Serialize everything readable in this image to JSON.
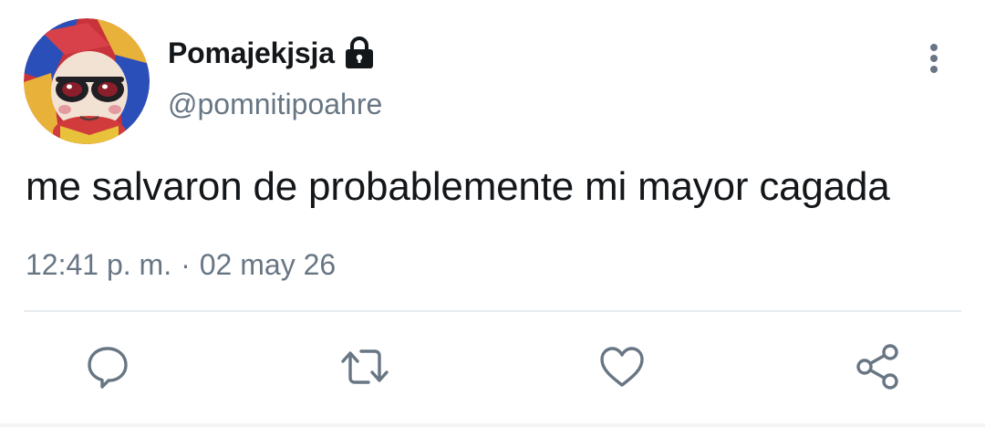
{
  "user": {
    "display_name": "Pomajekjsja",
    "handle": "@pomnitipoahre",
    "protected_icon": "lock-icon",
    "avatar_icon": "avatar-image"
  },
  "tweet": {
    "text": "me salvaron de probablemente mi mayor cagada",
    "time": "12:41 p. m.",
    "separator": "·",
    "date": "02 may 26"
  },
  "actions": {
    "reply_icon": "reply-icon",
    "retweet_icon": "retweet-icon",
    "like_icon": "heart-icon",
    "share_icon": "share-icon",
    "more_icon": "more-vertical-icon"
  },
  "colors": {
    "text_primary": "#14171a",
    "text_secondary": "#687684",
    "icon_gray": "#687684",
    "divider": "#e6ecf0"
  }
}
